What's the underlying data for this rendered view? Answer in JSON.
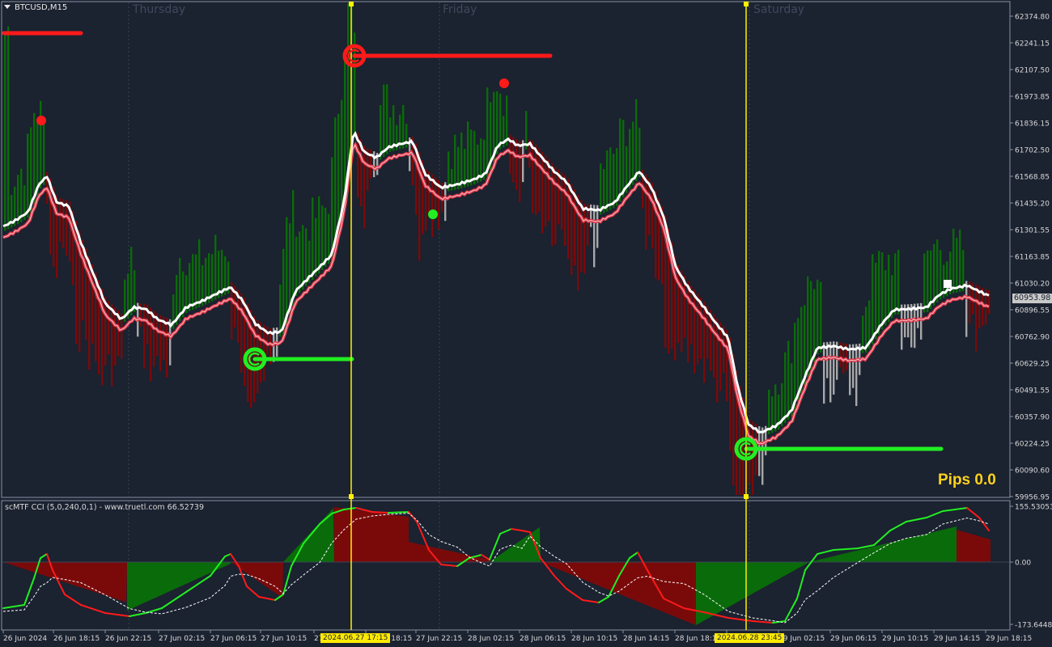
{
  "symbol": "BTCUSD,M15",
  "days": [
    "Thursday",
    "Friday",
    "Saturday"
  ],
  "price_axis": {
    "labels": [
      "62374.80",
      "62241.15",
      "62107.50",
      "61973.85",
      "61836.15",
      "61702.50",
      "61568.85",
      "61435.20",
      "61301.55",
      "61163.85",
      "61030.20",
      "60896.55",
      "60762.90",
      "60629.25",
      "60491.55",
      "60357.90",
      "60224.25",
      "60090.60",
      "59956.95"
    ],
    "current_price": "60953.98",
    "max": 62374.8,
    "min": 59956.95
  },
  "indicator": {
    "label": "scMTF CCI (5,0,240,0,1) - www.truetl.com 66.52739",
    "axis_labels": [
      "155.53053",
      "0.00",
      "-173.64485"
    ],
    "max": 155.53053,
    "min": -173.64485
  },
  "time_axis": [
    "26 Jun 2024",
    "26 Jun 18:15",
    "26 Jun 22:15",
    "27 Jun 02:15",
    "27 Jun 06:15",
    "27 Jun 10:15",
    "27 Jun 14:15",
    "27 Jun 18:15",
    "27 Jun 22:15",
    "28 Jun 02:15",
    "28 Jun 06:15",
    "28 Jun 10:15",
    "28 Jun 14:15",
    "28 Jun 18:15",
    "28 Jun 22:15",
    "29 Jun 02:15",
    "29 Jun 06:15",
    "29 Jun 10:15",
    "29 Jun 14:15",
    "29 Jun 18:15"
  ],
  "vertical_line_tags": [
    "2024.06.27 17:15",
    "2024.06.28 23:45"
  ],
  "pips_label": "Pips 0.0",
  "colors": {
    "background": "#1b2230",
    "bull": "#0a6b0a",
    "bear": "#7a0a0a",
    "neutral": "#a8a8a8",
    "white_ma": "#ffffff",
    "red_ma": "#e0384a",
    "vline": "#ffef00",
    "signal_red": "#ff1a1a",
    "signal_green": "#22ee22",
    "pips": "#ffd21a"
  },
  "icons": [
    "sell-signal-circle-icon",
    "buy-signal-circle-icon",
    "red-dot-marker-icon",
    "green-dot-marker-icon",
    "white-square-marker-icon",
    "dropdown-arrow-icon"
  ]
}
